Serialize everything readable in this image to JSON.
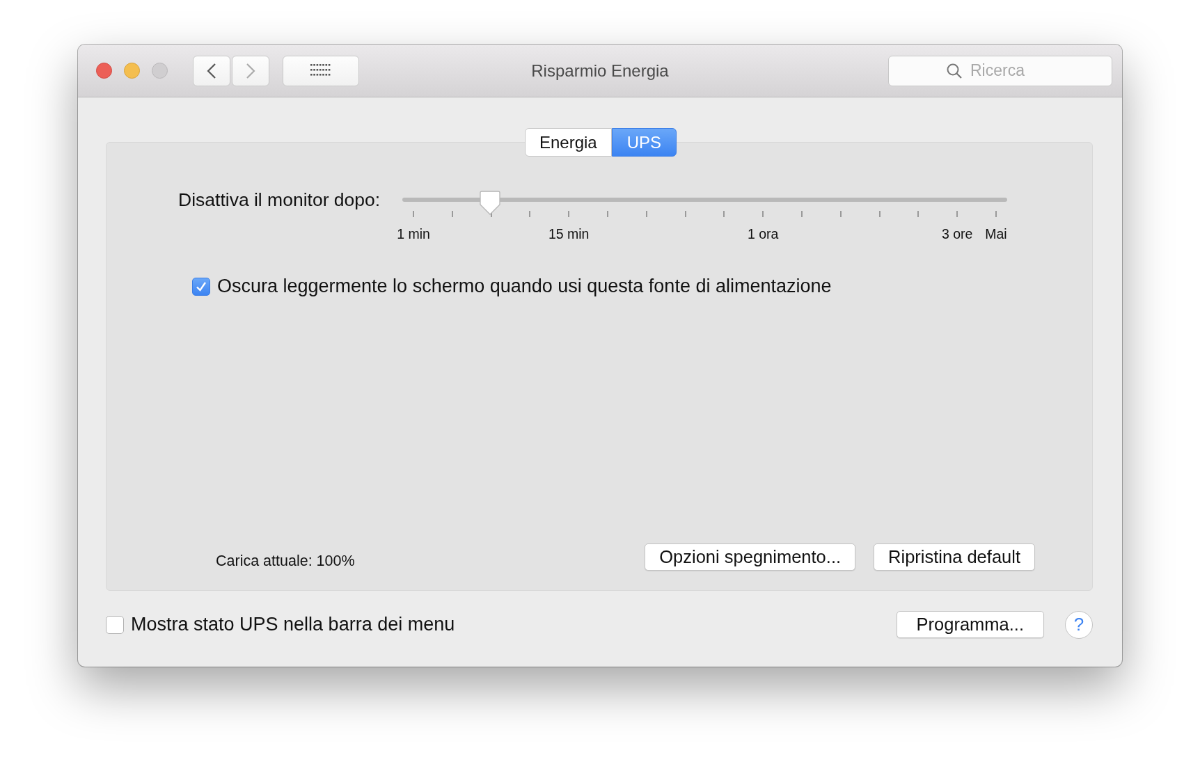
{
  "window": {
    "title": "Risparmio Energia"
  },
  "search": {
    "placeholder": "Ricerca"
  },
  "tabs": [
    {
      "label": "Energia",
      "selected": false
    },
    {
      "label": "UPS",
      "selected": true
    }
  ],
  "slider": {
    "label": "Disattiva il monitor dopo:",
    "level": 0.133,
    "ticks": [
      {
        "kind": "major",
        "label": "1 min"
      },
      {
        "kind": "minor"
      },
      {
        "kind": "minor"
      },
      {
        "kind": "minor"
      },
      {
        "kind": "major",
        "label": "15 min"
      },
      {
        "kind": "minor"
      },
      {
        "kind": "minor"
      },
      {
        "kind": "minor"
      },
      {
        "kind": "minor"
      },
      {
        "kind": "major",
        "label": "1 ora"
      },
      {
        "kind": "minor"
      },
      {
        "kind": "minor"
      },
      {
        "kind": "minor"
      },
      {
        "kind": "minor"
      },
      {
        "kind": "major",
        "label": "3 ore"
      },
      {
        "kind": "major",
        "label": "Mai"
      }
    ]
  },
  "dim_option": {
    "label": "Oscura leggermente lo schermo quando usi questa fonte di alimentazione",
    "checked": true
  },
  "charge": "Carica attuale: 100%",
  "panel_buttons": [
    "Opzioni spegnimento...",
    "Ripristina default"
  ],
  "menu_option": {
    "label": "Mostra stato UPS nella barra dei menu",
    "checked": false
  },
  "schedule_button": "Programma...",
  "help": "?"
}
